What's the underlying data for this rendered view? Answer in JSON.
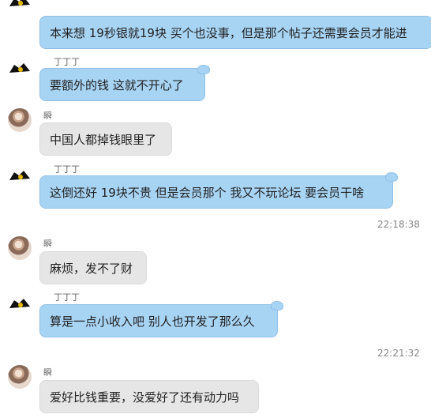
{
  "messages": [
    {
      "kind": "blue",
      "text": "本来想 19秒银就19块 买个也没事，但是那个帖子还需要会员才能进"
    },
    {
      "kind": "blue",
      "sender": "丁丁丁",
      "text": "要额外的钱 这就不开心了"
    },
    {
      "kind": "gray",
      "sender": "瞬",
      "text": "中国人都掉钱眼里了"
    },
    {
      "kind": "blue",
      "sender": "丁丁丁",
      "text": "这倒还好 19块不贵 但是会员那个 我又不玩论坛 要会员干啥"
    },
    {
      "kind": "time",
      "text": "22:18:38"
    },
    {
      "kind": "gray",
      "sender": "瞬",
      "text": "麻烦，发不了财"
    },
    {
      "kind": "blue",
      "sender": "丁丁丁",
      "text": "算是一点小收入吧 别人也开发了那么久"
    },
    {
      "kind": "time",
      "text": "22:21:32"
    },
    {
      "kind": "gray",
      "sender": "瞬",
      "text": "爱好比钱重要，没爱好了还有动力吗"
    }
  ]
}
